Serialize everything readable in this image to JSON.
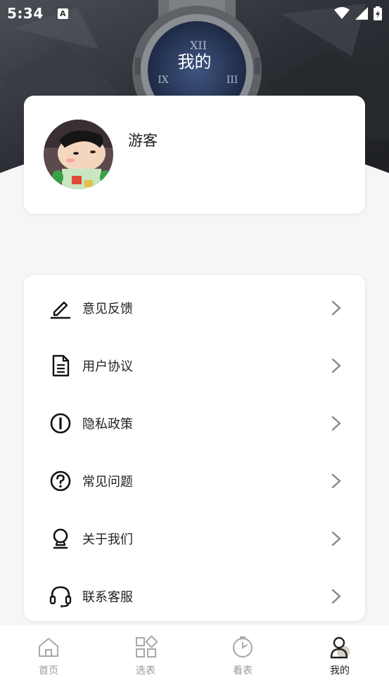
{
  "status": {
    "time": "5:34",
    "notification_icon": "A"
  },
  "header": {
    "title": "我的"
  },
  "profile": {
    "name": "游客"
  },
  "menu": {
    "items": [
      {
        "label": "意见反馈",
        "icon": "pen-icon"
      },
      {
        "label": "用户协议",
        "icon": "document-icon"
      },
      {
        "label": "隐私政策",
        "icon": "info-circle-icon"
      },
      {
        "label": "常见问题",
        "icon": "question-circle-icon"
      },
      {
        "label": "关于我们",
        "icon": "pin-icon"
      },
      {
        "label": "联系客服",
        "icon": "headset-icon"
      }
    ]
  },
  "tabs": [
    {
      "label": "首页",
      "icon": "home-icon",
      "active": false
    },
    {
      "label": "选表",
      "icon": "grid-icon",
      "active": false
    },
    {
      "label": "看表",
      "icon": "clock-icon",
      "active": false
    },
    {
      "label": "我的",
      "icon": "user-icon",
      "active": true
    }
  ],
  "colors": {
    "accent": "#222222",
    "inactive": "#9a9a9a",
    "background": "#f6f6f6"
  }
}
